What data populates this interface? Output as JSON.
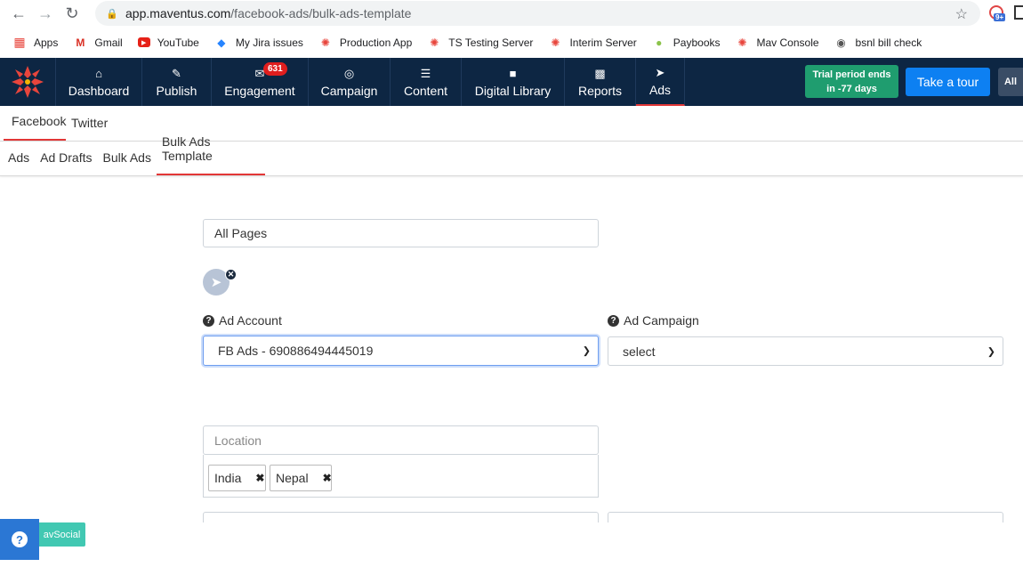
{
  "browser": {
    "url_host": "app.maventus.com",
    "url_path": "/facebook-ads/bulk-ads-template",
    "extension_badge": "9+"
  },
  "bookmarks": [
    {
      "label": "Apps",
      "icon": "apps-grid-icon"
    },
    {
      "label": "Gmail",
      "icon": "gmail-icon"
    },
    {
      "label": "YouTube",
      "icon": "youtube-icon"
    },
    {
      "label": "My Jira issues",
      "icon": "jira-icon"
    },
    {
      "label": "Production App",
      "icon": "maventus-icon"
    },
    {
      "label": "TS Testing Server",
      "icon": "maventus-icon"
    },
    {
      "label": "Interim Server",
      "icon": "maventus-icon"
    },
    {
      "label": "Paybooks",
      "icon": "paybooks-icon"
    },
    {
      "label": "Mav Console",
      "icon": "maventus-icon"
    },
    {
      "label": "bsnl bill check",
      "icon": "globe-icon"
    }
  ],
  "nav": {
    "items": [
      {
        "label": "Dashboard",
        "icon": "home-icon"
      },
      {
        "label": "Publish",
        "icon": "edit-icon"
      },
      {
        "label": "Engagement",
        "icon": "envelope-icon",
        "badge": "631"
      },
      {
        "label": "Campaign",
        "icon": "target-icon"
      },
      {
        "label": "Content",
        "icon": "list-icon"
      },
      {
        "label": "Digital Library",
        "icon": "briefcase-icon"
      },
      {
        "label": "Reports",
        "icon": "bar-chart-icon"
      },
      {
        "label": "Ads",
        "icon": "paper-plane-icon"
      }
    ],
    "active": "Ads",
    "trial_line1": "Trial period ends",
    "trial_line2": "in -77 days",
    "tour_label": "Take a tour",
    "all_label": "All"
  },
  "tabs_platform": [
    "Facebook",
    "Twitter"
  ],
  "tabs_ads": [
    "Ads",
    "Ad Drafts",
    "Bulk Ads",
    "Bulk Ads Template"
  ],
  "form": {
    "page_select": "All Pages",
    "ad_account_label": "Ad Account",
    "ad_account_value": "FB Ads - 690886494445019",
    "ad_campaign_label": "Ad Campaign",
    "ad_campaign_value": "select",
    "location_placeholder": "Location",
    "locations": [
      "India",
      "Nepal"
    ]
  },
  "help": {
    "label": "avSocial"
  },
  "colors": {
    "nav_bg": "#0d2643",
    "active_red": "#e23737",
    "trial_green": "#1f9d6f",
    "tour_blue": "#0d80f2",
    "help_blue": "#2b77d4",
    "help_teal": "#41c8b2"
  }
}
